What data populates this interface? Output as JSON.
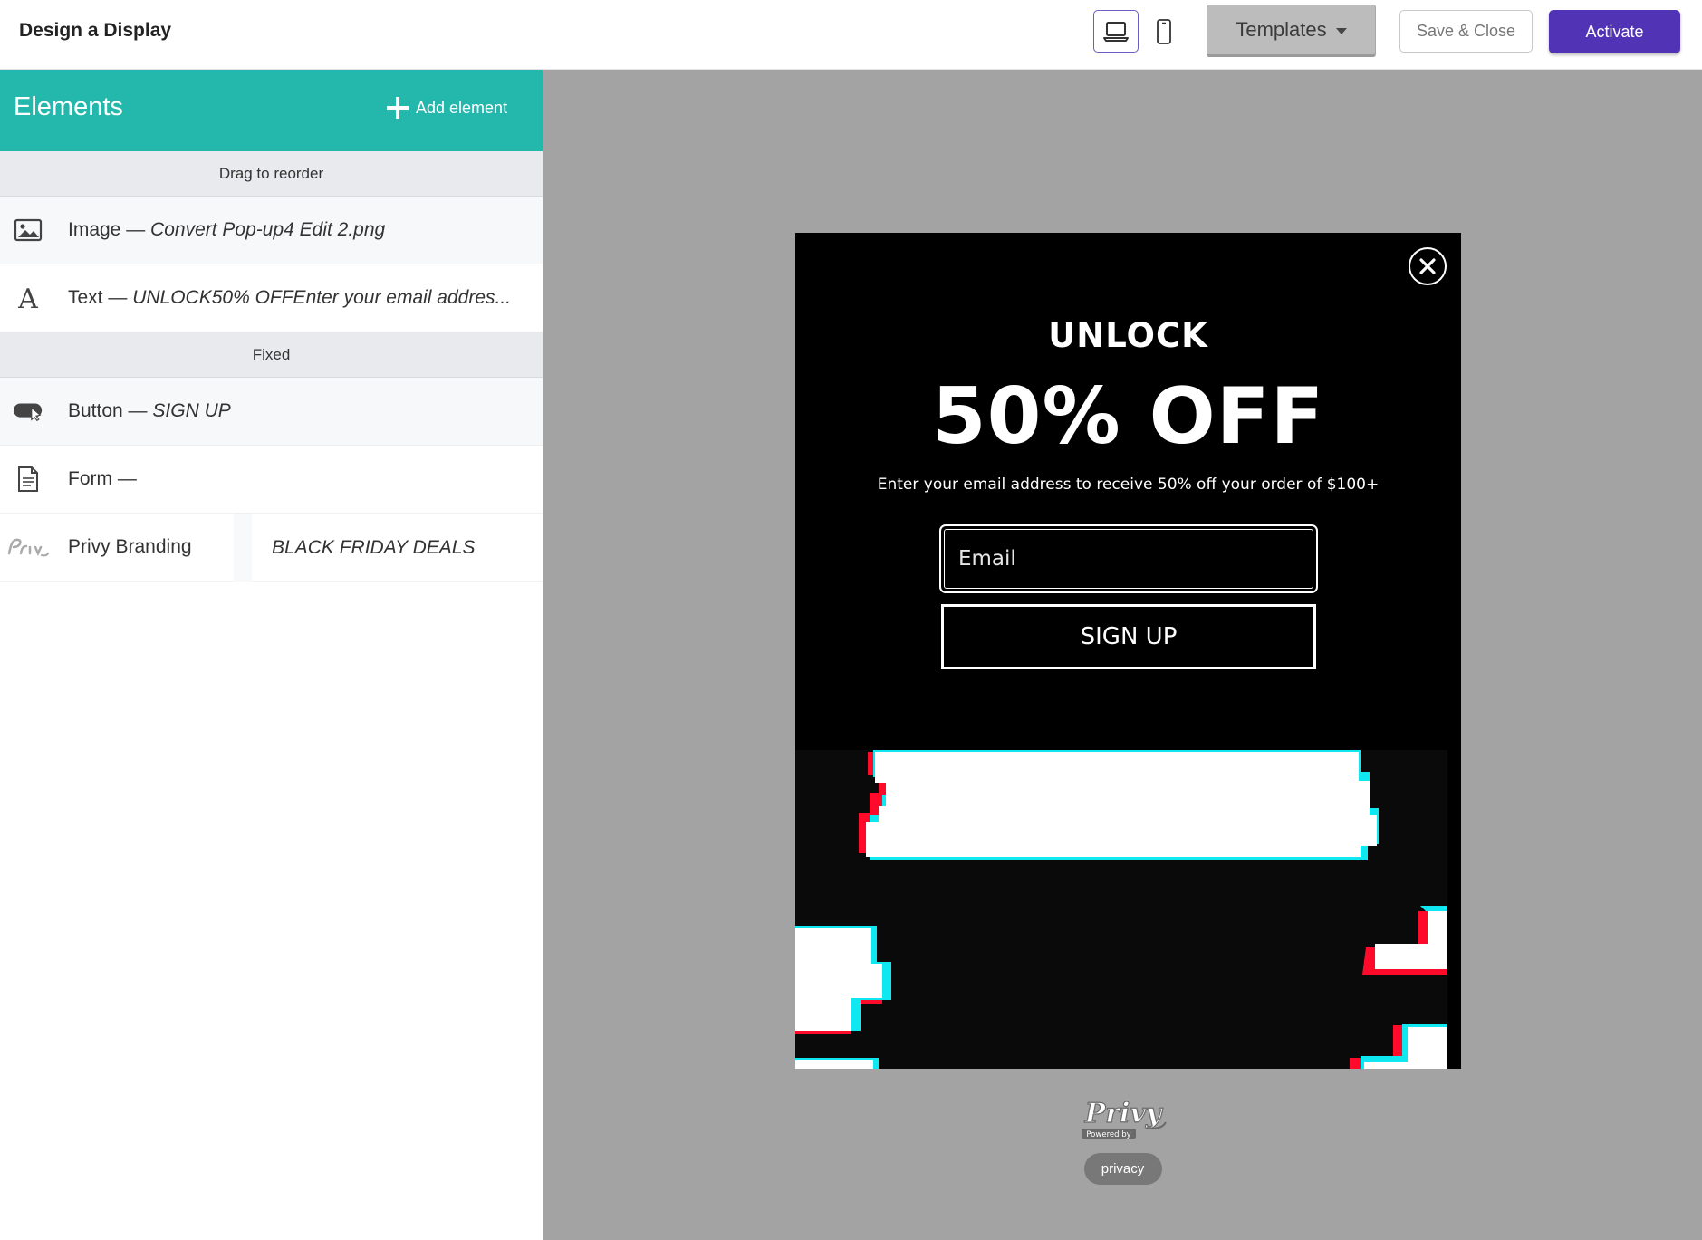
{
  "header": {
    "title": "Design a Display",
    "templates_label": "Templates",
    "save_label": "Save & Close",
    "activate_label": "Activate",
    "icons": {
      "desktop": "laptop-icon",
      "mobile": "mobile-phone-icon",
      "templates_caret": "caret-down-icon"
    }
  },
  "sidebar": {
    "title": "Elements",
    "add_label": "Add element",
    "sections": [
      {
        "label": "Drag to reorder"
      },
      {
        "label": "Fixed"
      }
    ],
    "items": [
      {
        "type": "Image",
        "separator": " — ",
        "detail": "Convert Pop-up4 Edit 2.png",
        "icon": "image-icon"
      },
      {
        "type": "Text",
        "separator": " — ",
        "detail": "UNLOCK50% OFFEnter your email addres...",
        "icon": "text-icon"
      },
      {
        "type": "Button",
        "separator": " — ",
        "detail": "SIGN UP",
        "icon": "button-icon"
      },
      {
        "type": "Form",
        "separator": " — ",
        "detail": "",
        "icon": "form-icon"
      },
      {
        "type": "Privy Branding",
        "separator": "",
        "detail": "BLACK FRIDAY DEALS",
        "icon": "privy-logo-icon"
      }
    ]
  },
  "popup": {
    "headline": "UNLOCK",
    "offer": "50% OFF",
    "subtext": "Enter your email address to receive 50% off your order of $100+",
    "email_placeholder": "Email",
    "button_label": "SIGN UP",
    "colors": {
      "background": "#000000",
      "text": "#ffffff",
      "glitch_red": "#ff0a2a",
      "glitch_cyan": "#0fe8f0"
    }
  },
  "footer": {
    "powered_by": "Powered by",
    "brand": "Privy",
    "privacy_label": "privacy"
  },
  "colors": {
    "sidebar_header": "#24b8ad",
    "activate": "#5133b5",
    "canvas": "#a3a3a3"
  }
}
